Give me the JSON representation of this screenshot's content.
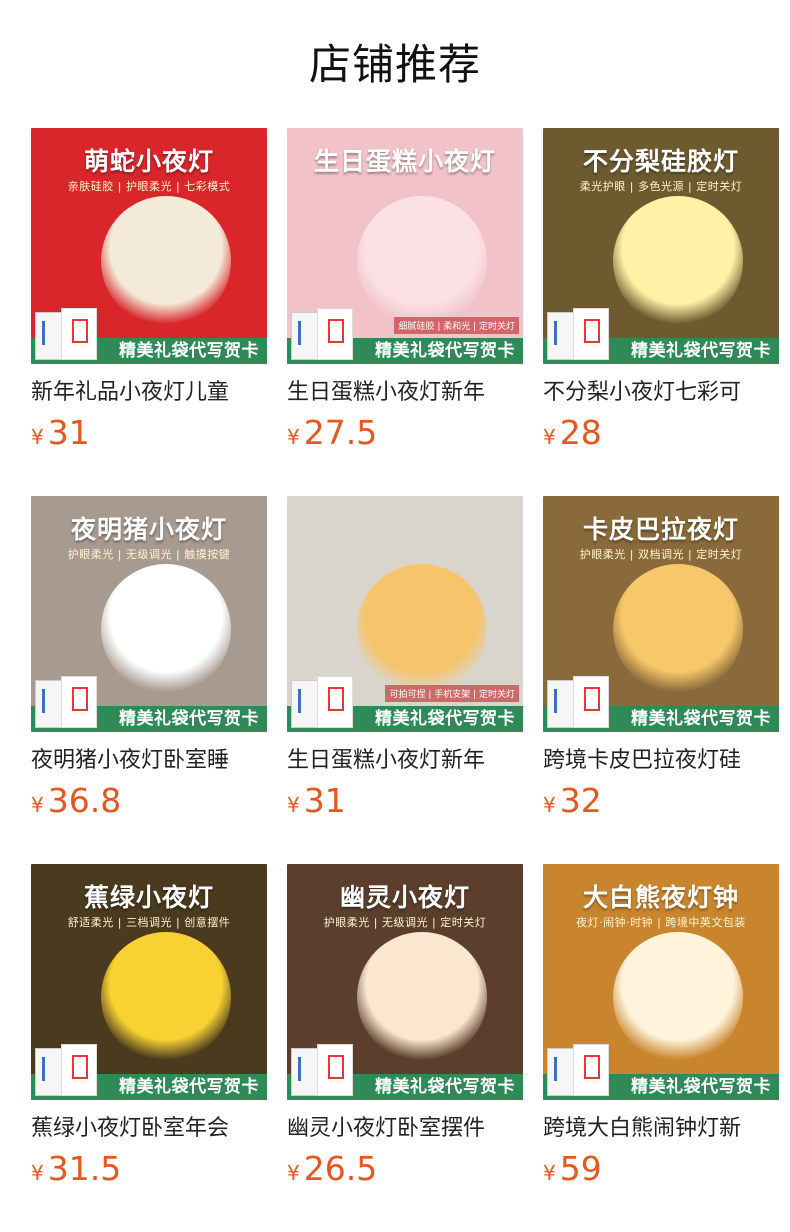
{
  "section": {
    "title": "店铺推荐"
  },
  "currency_symbol": "¥",
  "gift_banner": "精美礼袋代写贺卡",
  "products": [
    {
      "title": "新年礼品小夜灯儿童",
      "price": "31",
      "image": {
        "headline": "萌蛇小夜灯",
        "subline": "亲肤硅胶 | 护眼柔光 | 七彩模式",
        "feature": "",
        "bg": "#d8262a",
        "figure": "#f3ead8"
      }
    },
    {
      "title": "生日蛋糕小夜灯新年",
      "price": "27.5",
      "image": {
        "headline": "生日蛋糕小夜灯",
        "subline": "",
        "feature": "细腻硅胶 | 柔和光 | 定时关灯",
        "bg": "#f2c2c9",
        "figure": "#fbe1e6"
      }
    },
    {
      "title": "不分梨小夜灯七彩可",
      "price": "28",
      "image": {
        "headline": "不分梨硅胶灯",
        "subline": "柔光护眼 | 多色光源 | 定时关灯",
        "feature": "",
        "bg": "#6d5a2f",
        "figure": "#fff1a6"
      }
    },
    {
      "title": "夜明猪小夜灯卧室睡",
      "price": "36.8",
      "image": {
        "headline": "夜明猪小夜灯",
        "subline": "护眼柔光 | 无级调光 | 触摸按键",
        "feature": "",
        "bg": "#a79a90",
        "figure": "#ffffff"
      }
    },
    {
      "title": "生日蛋糕小夜灯新年",
      "price": "31",
      "image": {
        "headline": "",
        "subline": "",
        "feature": "可拍可捏 | 手机支架 | 定时关灯",
        "bg": "#d9d5cd",
        "figure": "#f6c46b"
      }
    },
    {
      "title": "跨境卡皮巴拉夜灯硅",
      "price": "32",
      "image": {
        "headline": "卡皮巴拉夜灯",
        "subline": "护眼柔光 | 双档调光 | 定时关灯",
        "feature": "",
        "bg": "#8a6a3a",
        "figure": "#f7c86a"
      }
    },
    {
      "title": "蕉绿小夜灯卧室年会",
      "price": "31.5",
      "image": {
        "headline": "蕉绿小夜灯",
        "subline": "舒适柔光 | 三档调光 | 创意摆件",
        "feature": "",
        "bg": "#4a3a1e",
        "figure": "#f8d233"
      }
    },
    {
      "title": "幽灵小夜灯卧室摆件",
      "price": "26.5",
      "image": {
        "headline": "幽灵小夜灯",
        "subline": "护眼柔光 | 无级调光 | 定时关灯",
        "feature": "",
        "bg": "#5b3f2c",
        "figure": "#fbe7cf"
      }
    },
    {
      "title": "跨境大白熊闹钟灯新",
      "price": "59",
      "image": {
        "headline": "大白熊夜灯钟",
        "subline": "夜灯·闹钟·时钟 | 跨境中英文包装",
        "feature": "",
        "bg": "#c9852d",
        "figure": "#fff3dc"
      }
    }
  ]
}
